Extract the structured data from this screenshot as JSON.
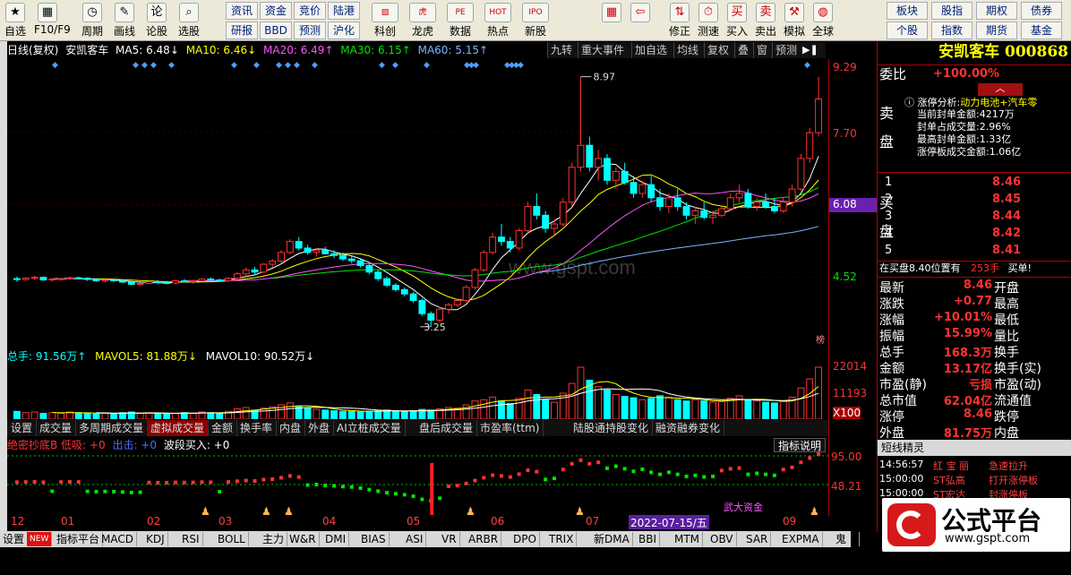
{
  "toolbar": {
    "left": [
      {
        "label": "自选",
        "icon": "star-icon",
        "g": "★"
      },
      {
        "label": "F10/F9",
        "icon": "f10-icon",
        "g": "▦"
      },
      {
        "label": "周期",
        "icon": "clock-icon",
        "g": "◷"
      },
      {
        "label": "画线",
        "icon": "pen-icon",
        "g": "✎"
      },
      {
        "label": "论股",
        "icon": "discuss-icon",
        "g": "论"
      },
      {
        "label": "选股",
        "icon": "search-stock-icon",
        "g": "⌕"
      }
    ],
    "mid_top": [
      "资讯",
      "资金",
      "竞价",
      "陆港"
    ],
    "mid_bottom": [
      "研报",
      "BBD",
      "预测",
      "沪化"
    ],
    "center": [
      {
        "label": "科创",
        "icon": "chart-icon",
        "g": "▨"
      },
      {
        "label": "龙虎",
        "icon": "tiger-icon",
        "g": "虎"
      },
      {
        "label": "数据",
        "icon": "pe-icon",
        "g": "PE"
      },
      {
        "label": "热点",
        "icon": "hot-icon",
        "g": "HOT"
      },
      {
        "label": "新股",
        "icon": "ipo-icon",
        "g": "IPO"
      }
    ],
    "nav": [
      {
        "label": "",
        "icon": "grid-icon",
        "g": "▦"
      },
      {
        "label": "",
        "icon": "back-arrow-icon",
        "g": "⇦"
      },
      {
        "label": "修正",
        "icon": "up-down-icon",
        "g": "⇅"
      },
      {
        "label": "测速",
        "icon": "speed-icon",
        "g": "⏱"
      },
      {
        "label": "买入",
        "icon": "buy-icon",
        "g": "买"
      },
      {
        "label": "卖出",
        "icon": "sell-icon",
        "g": "卖"
      },
      {
        "label": "模拟",
        "icon": "hammer-icon",
        "g": "⚒"
      },
      {
        "label": "全球",
        "icon": "globe-icon",
        "g": "◍"
      }
    ],
    "right_top": [
      "板块",
      "股指",
      "期权",
      "债券"
    ],
    "right_bottom": [
      "个股",
      "指数",
      "期货",
      "基金"
    ]
  },
  "chart_header": {
    "title": "日线(复权)",
    "name": "安凯客车",
    "ma5": "MA5: 6.48↓",
    "ma10": "MA10: 6.46↓",
    "ma20": "MA20: 6.49↑",
    "ma30": "MA30: 6.15↑",
    "ma60": "MA60: 5.15↑"
  },
  "top_tabs": [
    "九转",
    "重大事件",
    "加自选",
    "均线",
    "复权",
    "叠",
    "窗",
    "预测"
  ],
  "y_axis": {
    "main": [
      "9.29",
      "7.70",
      "6.08",
      "4.52"
    ],
    "vol": [
      "22014",
      "11193",
      "X100"
    ],
    "ind": [
      "95.00",
      "48.21"
    ],
    "current_tag": "6.08"
  },
  "annotations": {
    "high": "8.97",
    "low": "3.25",
    "watermark": "www.gspt.com",
    "corner": "榜"
  },
  "volume_header": {
    "total": "总手: 91.56万↑",
    "mavol5": "MAVOL5: 81.88万↓",
    "mavol10": "MAVOL10: 90.52万↓"
  },
  "mid_tabs": [
    "设置",
    "成交量",
    "多周期成交量",
    "虚拟成交量",
    "金额",
    "换手率",
    "内盘",
    "外盘",
    "AI立桩成交量",
    "盘后成交量",
    "市盈率(ttm)",
    "陆股通持股变化",
    "融资融券变化"
  ],
  "indicator_header": {
    "a": "绝密抄底B 低吸: +0",
    "b": "出击: +0",
    "c": "波段买入: +0",
    "btn": "指标说明",
    "label": "武大资金"
  },
  "x_axis": [
    "12",
    "01",
    "02",
    "03",
    "04",
    "05",
    "06",
    "07",
    "09"
  ],
  "x_cursor": "2022-07-15/五",
  "bottom_tabs": [
    "设置",
    "NEW",
    "指标平台",
    "MACD",
    "KDJ",
    "RSI",
    "BOLL",
    "主力",
    "W&R",
    "DMI",
    "BIAS",
    "ASI",
    "VR",
    "ARBR",
    "DPO",
    "TRIX",
    "新DMA",
    "BBI",
    "MTM",
    "OBV",
    "SAR",
    "EXPMA",
    "鬼谷神..."
  ],
  "panel": {
    "name": "安凯客车",
    "code": "000868",
    "weibi_label": "委比",
    "weibi": "+100.00%",
    "limit_title": "涨停分析:",
    "limit_concept": "动力电池+汽车零",
    "limit_lines": [
      [
        "当前封单金额:",
        "4217万"
      ],
      [
        "封单占成交量:",
        "2.96%"
      ],
      [
        "最高封单金额:",
        "1.33亿"
      ],
      [
        "涨停板成交金额:",
        "1.06亿"
      ]
    ],
    "sell_label": "卖盘",
    "buy_label": "买盘",
    "buys": [
      [
        "1",
        "8.46"
      ],
      [
        "2",
        "8.45"
      ],
      [
        "3",
        "8.44"
      ],
      [
        "4",
        "8.42"
      ],
      [
        "5",
        "8.41"
      ]
    ],
    "pos_line": "在买盘8.40位置有",
    "pos_vol": "253手",
    "pos_act": "买单!",
    "stats": [
      [
        "最新",
        "8.46",
        "开盘",
        ""
      ],
      [
        "涨跌",
        "+0.77",
        "最高",
        ""
      ],
      [
        "涨幅",
        "+10.01%",
        "最低",
        ""
      ],
      [
        "振幅",
        "15.99%",
        "量比",
        ""
      ],
      [
        "总手",
        "168.3万",
        "换手",
        ""
      ],
      [
        "金额",
        "13.17亿",
        "换手(实)",
        ""
      ],
      [
        "市盈(静)",
        "亏损",
        "市盈(动)",
        ""
      ],
      [
        "总市值",
        "62.04亿",
        "流通值",
        ""
      ],
      [
        "涨停",
        "8.46",
        "跌停",
        ""
      ],
      [
        "外盘",
        "81.75万",
        "内盘",
        ""
      ]
    ],
    "short_title": "短线精灵",
    "short": [
      [
        "14:56:57",
        "红 宝 丽",
        "急速拉升"
      ],
      [
        "15:00:00",
        "ST弘高",
        "打开涨停板"
      ],
      [
        "15:00:00",
        "ST宏达",
        "封涨停板"
      ]
    ]
  },
  "logo": {
    "text": "公式平台",
    "url": "www.gspt.com"
  },
  "chart_data": {
    "type": "candlestick",
    "ylim": [
      3.0,
      9.29
    ],
    "candles": [
      [
        4.35,
        4.4,
        4.28,
        4.33
      ],
      [
        4.33,
        4.38,
        4.3,
        4.36
      ],
      [
        4.36,
        4.42,
        4.32,
        4.38
      ],
      [
        4.38,
        4.4,
        4.3,
        4.32
      ],
      [
        4.32,
        4.36,
        4.28,
        4.34
      ],
      [
        4.34,
        4.36,
        4.3,
        4.35
      ],
      [
        4.35,
        4.4,
        4.32,
        4.37
      ],
      [
        4.37,
        4.4,
        4.34,
        4.36
      ],
      [
        4.36,
        4.38,
        4.3,
        4.33
      ],
      [
        4.33,
        4.36,
        4.28,
        4.3
      ],
      [
        4.3,
        4.34,
        4.26,
        4.32
      ],
      [
        4.32,
        4.35,
        4.28,
        4.3
      ],
      [
        4.3,
        4.33,
        4.25,
        4.27
      ],
      [
        4.27,
        4.3,
        4.2,
        4.22
      ],
      [
        4.22,
        4.26,
        4.18,
        4.24
      ],
      [
        4.24,
        4.3,
        4.22,
        4.28
      ],
      [
        4.28,
        4.32,
        4.24,
        4.26
      ],
      [
        4.26,
        4.3,
        4.22,
        4.25
      ],
      [
        4.25,
        4.32,
        4.22,
        4.3
      ],
      [
        4.3,
        4.34,
        4.26,
        4.28
      ],
      [
        4.28,
        4.32,
        4.24,
        4.3
      ],
      [
        4.3,
        4.36,
        4.28,
        4.34
      ],
      [
        4.34,
        4.38,
        4.3,
        4.32
      ],
      [
        4.32,
        4.35,
        4.28,
        4.3
      ],
      [
        4.3,
        4.38,
        4.28,
        4.36
      ],
      [
        4.36,
        4.5,
        4.34,
        4.46
      ],
      [
        4.46,
        4.6,
        4.4,
        4.55
      ],
      [
        4.55,
        4.62,
        4.45,
        4.5
      ],
      [
        4.5,
        4.7,
        4.48,
        4.68
      ],
      [
        4.68,
        4.8,
        4.6,
        4.75
      ],
      [
        4.75,
        5.0,
        4.7,
        4.95
      ],
      [
        4.95,
        5.25,
        4.9,
        5.2
      ],
      [
        5.2,
        5.3,
        5.0,
        5.05
      ],
      [
        5.05,
        5.12,
        4.9,
        4.95
      ],
      [
        4.95,
        5.05,
        4.85,
        5.0
      ],
      [
        5.0,
        5.08,
        4.9,
        4.92
      ],
      [
        4.92,
        5.0,
        4.82,
        4.88
      ],
      [
        4.88,
        4.95,
        4.75,
        4.8
      ],
      [
        4.8,
        4.88,
        4.7,
        4.76
      ],
      [
        4.76,
        4.82,
        4.6,
        4.65
      ],
      [
        4.65,
        4.7,
        4.45,
        4.5
      ],
      [
        4.5,
        4.55,
        4.3,
        4.35
      ],
      [
        4.35,
        4.4,
        4.15,
        4.2
      ],
      [
        4.2,
        4.25,
        4.05,
        4.1
      ],
      [
        4.1,
        4.15,
        3.95,
        4.0
      ],
      [
        4.0,
        4.05,
        3.8,
        3.85
      ],
      [
        3.85,
        3.9,
        3.5,
        3.55
      ],
      [
        3.55,
        3.6,
        3.25,
        3.4
      ],
      [
        3.4,
        3.7,
        3.35,
        3.65
      ],
      [
        3.65,
        3.8,
        3.55,
        3.75
      ],
      [
        3.75,
        3.9,
        3.7,
        3.85
      ],
      [
        3.85,
        4.2,
        3.8,
        4.15
      ],
      [
        4.15,
        4.6,
        4.1,
        4.55
      ],
      [
        4.55,
        5.0,
        4.5,
        4.95
      ],
      [
        4.95,
        5.4,
        4.9,
        5.3
      ],
      [
        5.3,
        5.6,
        5.1,
        5.2
      ],
      [
        5.2,
        5.3,
        4.95,
        5.05
      ],
      [
        5.05,
        5.5,
        5.0,
        5.45
      ],
      [
        5.45,
        6.1,
        5.4,
        6.0
      ],
      [
        6.0,
        6.3,
        5.7,
        5.8
      ],
      [
        5.8,
        5.9,
        5.4,
        5.5
      ],
      [
        5.5,
        5.7,
        5.35,
        5.6
      ],
      [
        5.6,
        6.2,
        5.55,
        6.1
      ],
      [
        6.1,
        7.0,
        6.0,
        6.9
      ],
      [
        6.9,
        8.97,
        6.8,
        7.4
      ],
      [
        7.4,
        7.6,
        6.8,
        6.9
      ],
      [
        6.9,
        7.3,
        6.6,
        7.1
      ],
      [
        7.1,
        7.2,
        6.5,
        6.6
      ],
      [
        6.6,
        6.9,
        6.4,
        6.8
      ],
      [
        6.8,
        7.0,
        6.5,
        6.55
      ],
      [
        6.55,
        6.7,
        6.2,
        6.3
      ],
      [
        6.3,
        6.6,
        6.2,
        6.5
      ],
      [
        6.5,
        6.7,
        6.1,
        6.2
      ],
      [
        6.2,
        6.4,
        5.9,
        6.0
      ],
      [
        6.0,
        6.3,
        5.85,
        6.2
      ],
      [
        6.2,
        6.4,
        5.9,
        6.0
      ],
      [
        6.0,
        6.1,
        5.7,
        5.8
      ],
      [
        5.8,
        6.0,
        5.6,
        5.9
      ],
      [
        5.9,
        6.1,
        5.7,
        5.75
      ],
      [
        5.75,
        5.9,
        5.6,
        5.8
      ],
      [
        5.8,
        6.0,
        5.75,
        5.95
      ],
      [
        5.95,
        6.3,
        5.9,
        6.2
      ],
      [
        6.2,
        6.5,
        6.1,
        6.3
      ],
      [
        6.3,
        6.4,
        5.95,
        6.0
      ],
      [
        6.0,
        6.2,
        5.9,
        6.1
      ],
      [
        6.1,
        6.3,
        5.95,
        6.0
      ],
      [
        6.0,
        6.2,
        5.85,
        5.9
      ],
      [
        5.9,
        6.2,
        5.85,
        6.1
      ],
      [
        6.1,
        6.5,
        6.0,
        6.4
      ],
      [
        6.4,
        7.2,
        6.35,
        7.1
      ],
      [
        7.1,
        7.8,
        7.0,
        7.69
      ],
      [
        7.69,
        8.97,
        7.6,
        8.46
      ]
    ],
    "volume": [
      12,
      10,
      11,
      9,
      10,
      9,
      11,
      10,
      9,
      8,
      9,
      8,
      10,
      11,
      9,
      10,
      9,
      8,
      9,
      10,
      9,
      11,
      10,
      9,
      12,
      16,
      18,
      14,
      17,
      19,
      22,
      25,
      20,
      17,
      15,
      14,
      13,
      12,
      12,
      11,
      12,
      13,
      14,
      13,
      12,
      13,
      15,
      14,
      16,
      18,
      17,
      22,
      28,
      30,
      34,
      28,
      24,
      32,
      45,
      38,
      30,
      26,
      40,
      55,
      80,
      60,
      50,
      45,
      38,
      35,
      33,
      30,
      32,
      36,
      34,
      30,
      28,
      30,
      28,
      26,
      27,
      32,
      36,
      30,
      28,
      26,
      25,
      28,
      34,
      48,
      62,
      80
    ]
  }
}
